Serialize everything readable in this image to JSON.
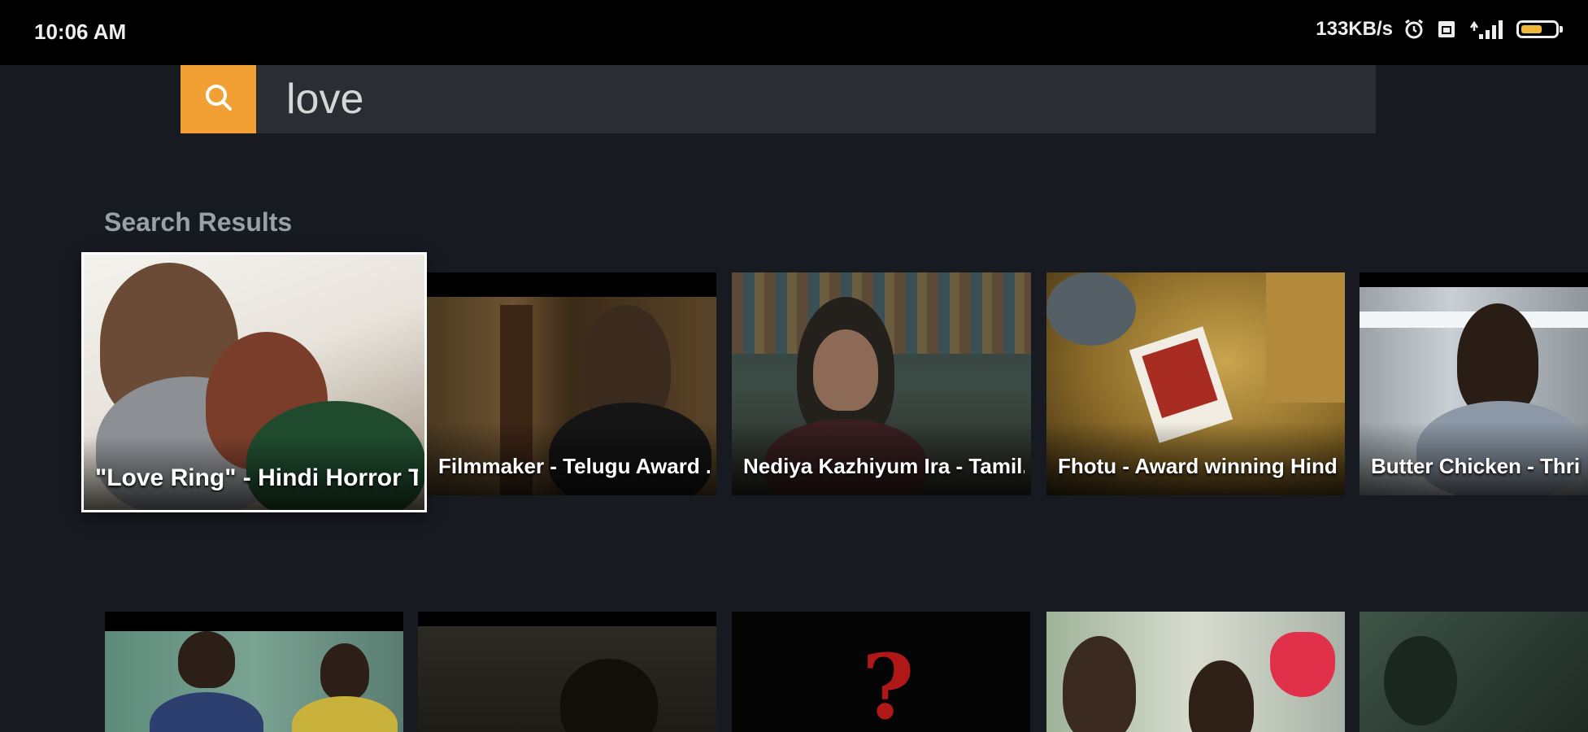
{
  "status_bar": {
    "time": "10:06 AM",
    "net_speed": "133KB/s",
    "icons": [
      "alarm-icon",
      "sim-icon",
      "signal-icon",
      "battery-icon"
    ],
    "battery_level": 0.55,
    "battery_color": "#f0b83a"
  },
  "search": {
    "icon": "search-icon",
    "query": "love",
    "accent_color": "#f2a034"
  },
  "results": {
    "title": "Search Results",
    "row1": [
      {
        "title": "\"Love Ring\" - Hindi Horror T..."
      },
      {
        "title": "Filmmaker - Telugu Award ..."
      },
      {
        "title": "Nediya Kazhiyum Ira - Tamil..."
      },
      {
        "title": "Fhotu - Award winning Hind..."
      },
      {
        "title": "Butter Chicken - Thriller"
      }
    ],
    "row2": [
      {
        "title": ""
      },
      {
        "title": ""
      },
      {
        "title": ""
      },
      {
        "title": ""
      },
      {
        "title": ""
      }
    ]
  }
}
